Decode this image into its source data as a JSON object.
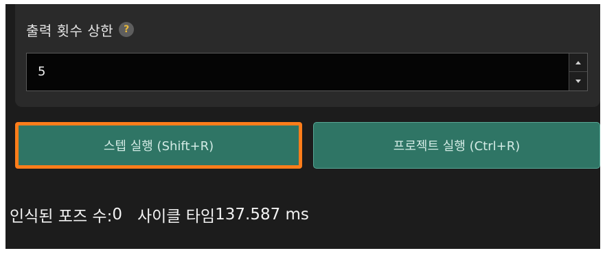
{
  "output_limit": {
    "label": "출력 횟수 상한",
    "help_glyph": "?",
    "value": "5"
  },
  "buttons": {
    "step_run": "스텝 실행 (Shift+R)",
    "project_run": "프로젝트 실행 (Ctrl+R)"
  },
  "status": {
    "recognized_label": "인식된 포즈 수:",
    "recognized_value": "0",
    "cycle_label": "사이클 타임",
    "cycle_value": "137.587 ms"
  },
  "colors": {
    "panel_bg": "#2a2a2a",
    "button_bg": "#2f7565",
    "highlight_border": "#ff7d1a"
  },
  "icons": {
    "help": "help-icon",
    "spin_up": "chevron-up-icon",
    "spin_down": "chevron-down-icon"
  }
}
